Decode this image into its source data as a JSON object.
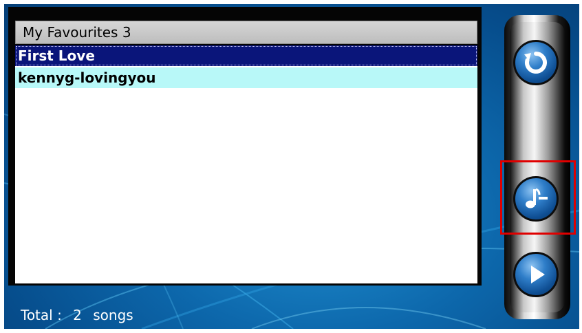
{
  "playlist": {
    "title": "My Favourites 3",
    "songs": [
      {
        "name": "First Love",
        "selected": true
      },
      {
        "name": "kennyg-lovingyou",
        "selected": false
      }
    ]
  },
  "footer": {
    "label": "Total :",
    "count": "2",
    "unit": "songs"
  },
  "controls": {
    "refresh_icon": "refresh-icon",
    "remove_song_icon": "music-note-minus-icon",
    "play_icon": "play-icon"
  },
  "colors": {
    "selected_row": "#0a157a",
    "row_highlight": "#b8f8f8",
    "highlight_box": "#e00000",
    "background": "#0d68ac"
  }
}
